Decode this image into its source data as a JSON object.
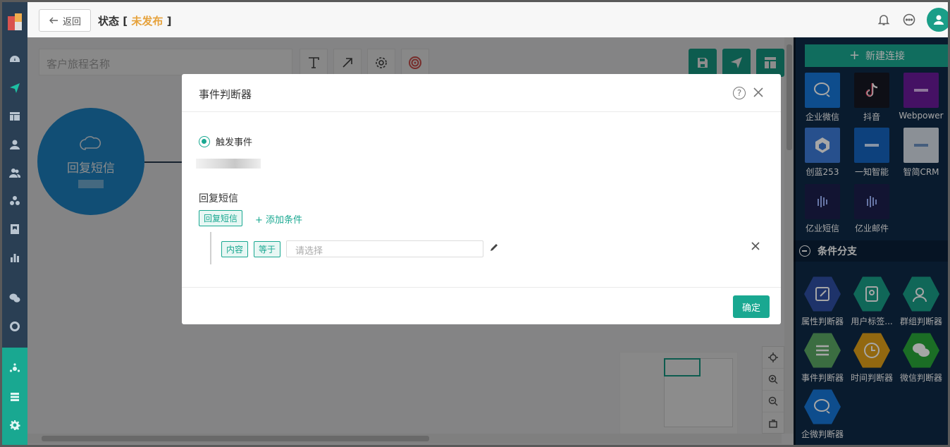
{
  "header": {
    "back_label": "返回",
    "title_prefix": "状态",
    "status": "未发布"
  },
  "canvas": {
    "name_placeholder": "客户旅程名称",
    "node_label": "回复短信"
  },
  "right_panel": {
    "new_connection_label": "新建连接",
    "channels": [
      {
        "label": "企业微信",
        "color": "#1677d9"
      },
      {
        "label": "抖音",
        "color": "#161823"
      },
      {
        "label": "Webpower",
        "color": "#6a1b9a"
      },
      {
        "label": "创蓝253",
        "color": "#3d7bd9"
      },
      {
        "label": "一知智能",
        "color": "#1565c0"
      },
      {
        "label": "智简CRM",
        "color": "#d6dde6"
      },
      {
        "label": "亿业短信",
        "color": "#1c1f4d"
      },
      {
        "label": "亿业邮件",
        "color": "#1c1f4d"
      }
    ],
    "section_title": "条件分支",
    "branches": [
      {
        "label": "属性判断器",
        "color": "#2f4fa3"
      },
      {
        "label": "用户标签...",
        "color": "#1a9e88"
      },
      {
        "label": "群组判断器",
        "color": "#1a9e88"
      },
      {
        "label": "事件判断器",
        "color": "#5ba865"
      },
      {
        "label": "时间判断器",
        "color": "#e0a01a"
      },
      {
        "label": "微信判断器",
        "color": "#2aa83a"
      },
      {
        "label": "企微判断器",
        "color": "#1677d9"
      }
    ]
  },
  "modal": {
    "title": "事件判断器",
    "radio_label": "触发事件",
    "section_label": "回复短信",
    "event_tag": "回复短信",
    "add_condition_label": "添加条件",
    "condition": {
      "field_tag": "内容",
      "operator_tag": "等于",
      "value_placeholder": "请选择"
    },
    "ok_label": "确定"
  }
}
